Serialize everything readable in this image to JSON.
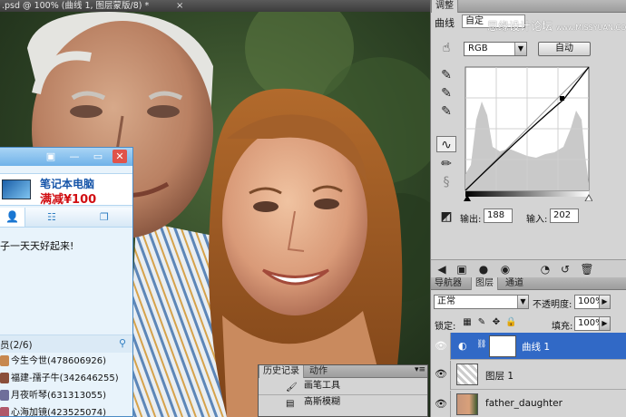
{
  "document": {
    "tab_title": ".psd @ 100% (曲线 1, 图层蒙版/8) *",
    "close_glyph": "×"
  },
  "adjust_panel": {
    "tabs": [
      "调整"
    ],
    "label": "曲线",
    "preset": "自定",
    "watermark": "思缘设计论坛",
    "watermark_url": "www.MISSYUAN.COM",
    "channel": "RGB",
    "auto_button": "自动",
    "output_label": "输出:",
    "output_value": "188",
    "input_label": "输入:",
    "input_value": "202",
    "control_point": {
      "input": 202,
      "output": 188
    }
  },
  "layers_panel": {
    "tabs": [
      "导航器",
      "图层",
      "通道"
    ],
    "blend_mode": "正常",
    "opacity_label": "不透明度:",
    "opacity_value": "100%",
    "lock_label": "锁定:",
    "fill_label": "填充:",
    "fill_value": "100%",
    "layers": [
      {
        "name": "曲线 1",
        "selected": true
      },
      {
        "name": "图层 1",
        "selected": false
      },
      {
        "name": "father_daughter",
        "selected": false
      }
    ]
  },
  "history_panel": {
    "tabs": [
      "历史记录",
      "动作"
    ],
    "items": [
      "画笔工具",
      "高斯模糊"
    ]
  },
  "qq_window": {
    "ad_title": "笔记本电脑",
    "ad_subtitle": "满减¥100",
    "status_text": "子一天天好起来!",
    "group_label": "员(2/6)",
    "contacts": [
      "今生今世(478606926)",
      "福建-孺子牛(342646255)",
      "月夜听琴(631313055)",
      "心海加镜(423525074)"
    ]
  },
  "colors": {
    "selection_blue": "#3169c6",
    "panel_gray": "#d4d4d4",
    "qq_blue": "#6fb2e8",
    "ad_red": "#d10f13"
  }
}
